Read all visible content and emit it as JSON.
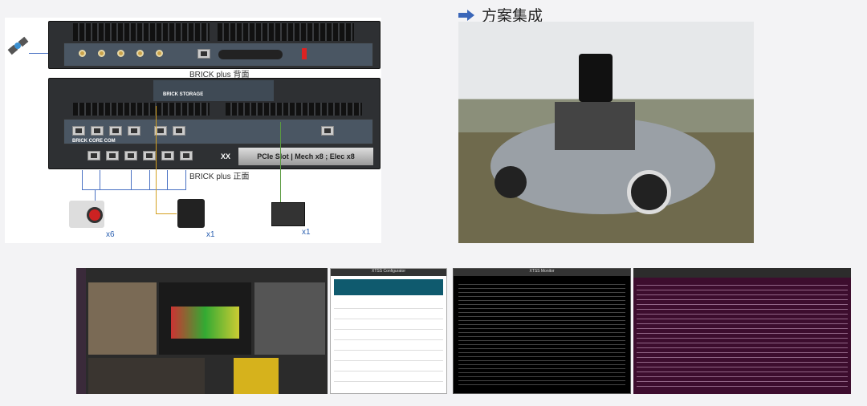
{
  "header": {
    "title": "方案集成",
    "arrow_icon": "arrow-right-icon",
    "arrow_color": "#3a66b8"
  },
  "diagram": {
    "back_caption": "BRICK plus 背面",
    "front_caption": "BRICK plus 正面",
    "storage_label": "BRICK STORAGE",
    "core_label": "BRICK CORE COM",
    "pcie_slot": "PCIe Slot | Mech x8 ; Elec x8",
    "slot_id": "XX",
    "camera_count": "x6",
    "lidar_count": "x1",
    "board_count": "x1"
  },
  "screens": {
    "configurator_title": "XTSS Configurator",
    "monitor_title": "XTSS Monitor"
  }
}
